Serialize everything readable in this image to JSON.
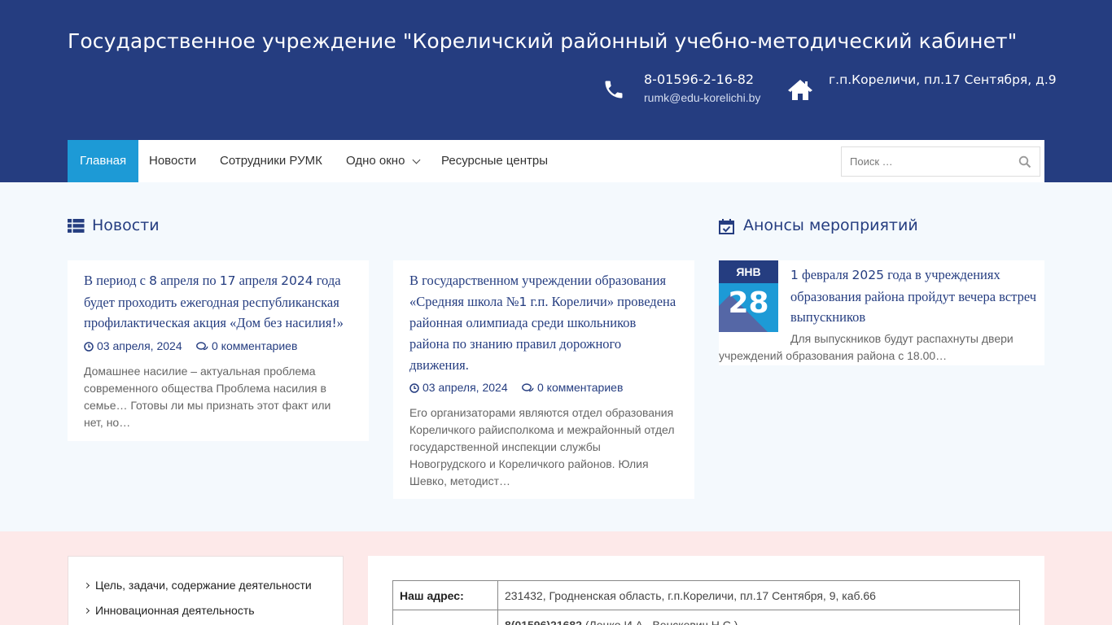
{
  "header": {
    "site_title": "Государственное учреждение \"Кореличский районный учебно-методический кабинет\"",
    "phone": "8-01596-2-16-82",
    "email": "rumk@edu-korelichi.by",
    "address": "г.п.Кореличи, пл.17 Сентября, д.9",
    "phone_icon": "phone-icon",
    "home_icon": "home-icon"
  },
  "nav": {
    "items": [
      {
        "label": "Главная",
        "active": true
      },
      {
        "label": "Новости"
      },
      {
        "label": "Сотрудники РУМК"
      },
      {
        "label": "Одно окно",
        "has_dropdown": true
      },
      {
        "label": "Ресурсные центры"
      }
    ],
    "search_placeholder": "Поиск …"
  },
  "news": {
    "title": "Новости",
    "posts": [
      {
        "title_parts": [
          "В период с ",
          "8",
          " апреля по ",
          "17",
          " апреля ",
          "2024",
          " года будет проходить ежегодная республиканская профилактическая акция «Дом без насилия",
          "!",
          "»"
        ],
        "date": "03 апреля, 2024",
        "comments": "0 комментариев",
        "excerpt": "Домашнее насилие – актуальная проблема современного общества Проблема насилия в семье… Готовы ли мы признать этот факт или нет, но…"
      },
      {
        "title_parts": [
          "В государственном учреждении образования «Средняя школа №",
          "1",
          " г.п. Кореличи» проведена районная олимпиада среди школьников района по знанию правил дорожного движения."
        ],
        "date": "03 апреля, 2024",
        "comments": "0 комментариев",
        "excerpt": "Его организаторами являются отдел образования Кореличкого райисполкома и межрайонный отдел государственной инспекции службы Новогрудского и Кореличкого районов. Юлия Шевко, методист…"
      }
    ]
  },
  "events": {
    "title": "Анонсы мероприятий",
    "items": [
      {
        "month": "ЯНВ",
        "day": "28",
        "title_parts": [
          "1",
          " февраля ",
          "2025",
          " года в учреждениях образования района пройдут вечера встреч выпускников"
        ],
        "excerpt": "Для выпускников будут распахнуты двери учреждений образования района с 18.00…"
      }
    ]
  },
  "sidebar": {
    "links": [
      "Цель, задачи, содержание деятельности",
      "Инновационная деятельность"
    ]
  },
  "contacts_table": {
    "rows": [
      {
        "label": "Наш адрес:",
        "value": "231432, Гродненская область, г.п.Кореличи, пл.17 Сентября, 9, каб.66"
      },
      {
        "label": "",
        "value_bold": "8(01596)21682",
        "value": " (Лецко И.А., Венскевич Н.С.)"
      }
    ]
  },
  "colors": {
    "header_bg": "#253d80",
    "accent": "#1d9ad6",
    "body_bg": "#f4f9fd",
    "bottom_bg": "#fde9e9"
  }
}
